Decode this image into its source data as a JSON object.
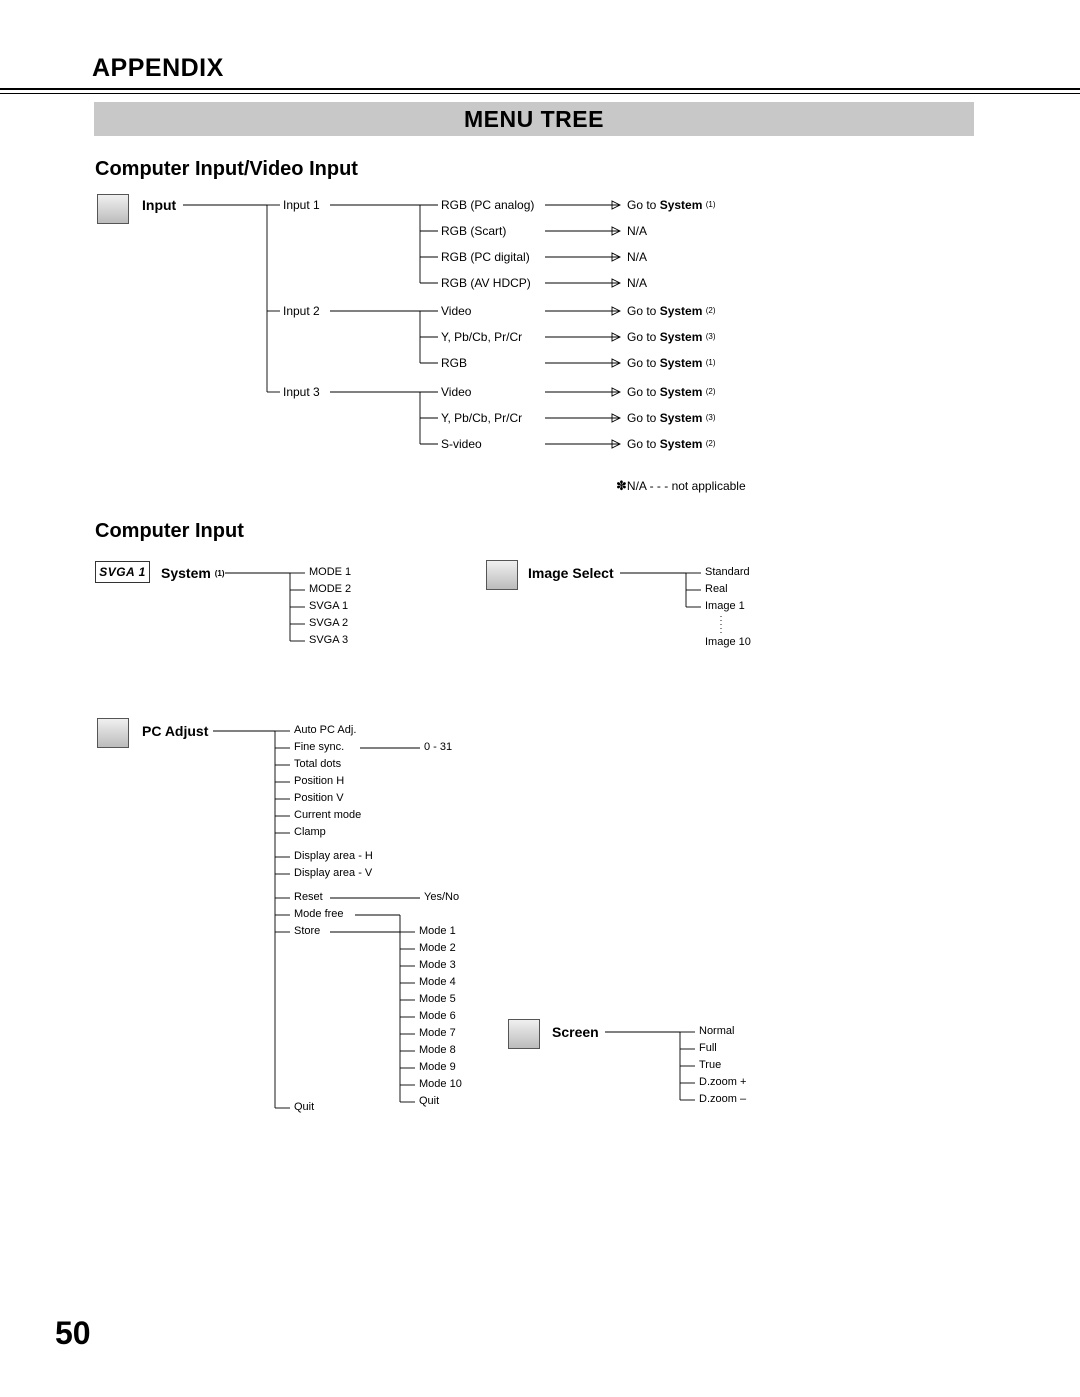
{
  "header": "APPENDIX",
  "band_title": "MENU TREE",
  "page_number": "50",
  "section1": {
    "title": "Computer Input/Video Input",
    "root": "Input",
    "branches": {
      "input1": {
        "label": "Input 1",
        "items": [
          "RGB (PC analog)",
          "RGB (Scart)",
          "RGB (PC digital)",
          "RGB (AV HDCP)"
        ]
      },
      "input2": {
        "label": "Input 2",
        "items": [
          "Video",
          "Y, Pb/Cb, Pr/Cr",
          "RGB"
        ]
      },
      "input3": {
        "label": "Input 3",
        "items": [
          "Video",
          "Y, Pb/Cb, Pr/Cr",
          "S-video"
        ]
      }
    },
    "destinations": {
      "goto_prefix": "Go to ",
      "goto_bold": "System",
      "sys1": "(1)",
      "sys2": "(2)",
      "sys3": "(3)",
      "na": "N/A"
    },
    "footnote_symbol": "✽",
    "footnote": "N/A - - - not applicable"
  },
  "section2": {
    "title": "Computer Input",
    "system": {
      "label": "System ",
      "sup": "(1)",
      "svga_icon": "SVGA 1",
      "items": [
        "MODE 1",
        "MODE 2",
        "SVGA 1",
        "SVGA 2",
        "SVGA 3"
      ]
    },
    "image_select": {
      "label": "Image Select",
      "items": [
        "Standard",
        "Real",
        "Image 1",
        "Image 10"
      ]
    },
    "pc_adjust": {
      "label": "PC Adjust",
      "items": [
        "Auto PC Adj.",
        "Fine sync.",
        "Total dots",
        "Position H",
        "Position V",
        "Current mode",
        "Clamp",
        "Display area - H",
        "Display area - V",
        "Reset",
        "Mode free",
        "Store",
        "Quit"
      ],
      "fine_sync_range": "0 - 31",
      "reset_value": "Yes/No",
      "store_modes": [
        "Mode 1",
        "Mode 2",
        "Mode 3",
        "Mode 4",
        "Mode 5",
        "Mode 6",
        "Mode 7",
        "Mode 8",
        "Mode 9",
        "Mode 10",
        "Quit"
      ]
    },
    "screen": {
      "label": "Screen",
      "items": [
        "Normal",
        "Full",
        "True",
        "D.zoom +",
        "D.zoom –"
      ]
    }
  }
}
